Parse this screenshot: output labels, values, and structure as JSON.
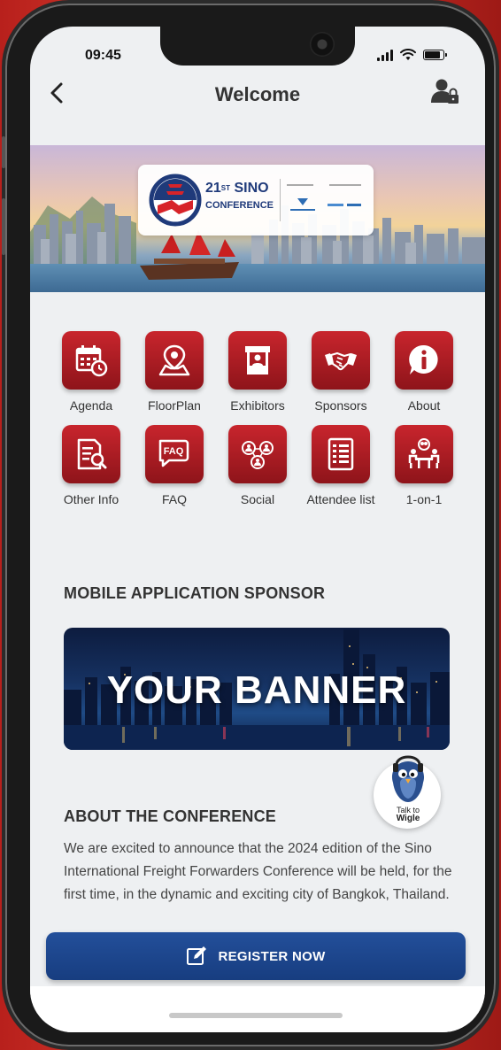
{
  "status_bar": {
    "time": "09:45"
  },
  "header": {
    "title": "Welcome"
  },
  "hero": {
    "edition": "21",
    "edition_suffix": "ST",
    "name_line1": "SINO",
    "name_line2": "CONFERENCE"
  },
  "menu": [
    {
      "label": "Agenda",
      "icon": "calendar-clock-icon"
    },
    {
      "label": "FloorPlan",
      "icon": "map-pin-icon"
    },
    {
      "label": "Exhibitors",
      "icon": "booth-icon"
    },
    {
      "label": "Sponsors",
      "icon": "handshake-icon"
    },
    {
      "label": "About",
      "icon": "info-bubble-icon"
    },
    {
      "label": "Other Info",
      "icon": "document-search-icon"
    },
    {
      "label": "FAQ",
      "icon": "faq-bubble-icon"
    },
    {
      "label": "Social",
      "icon": "people-network-icon"
    },
    {
      "label": "Attendee list",
      "icon": "checklist-icon"
    },
    {
      "label": "1-on-1",
      "icon": "meeting-table-icon"
    }
  ],
  "sponsor_section": {
    "title": "MOBILE APPLICATION SPONSOR",
    "banner_text": "YOUR BANNER"
  },
  "about_section": {
    "title": "ABOUT THE CONFERENCE",
    "body": "We are excited to announce that the 2024 edition of the Sino International Freight Forwarders Conference will be held, for the first time, in the dynamic and exciting city of Bangkok, Thailand."
  },
  "chatbot": {
    "line1": "Talk to",
    "line2": "Wigle"
  },
  "register_button": {
    "label": "REGISTER NOW"
  },
  "colors": {
    "menu_tile": "#b01e26",
    "register": "#1d4589",
    "background": "#eef0f2"
  }
}
